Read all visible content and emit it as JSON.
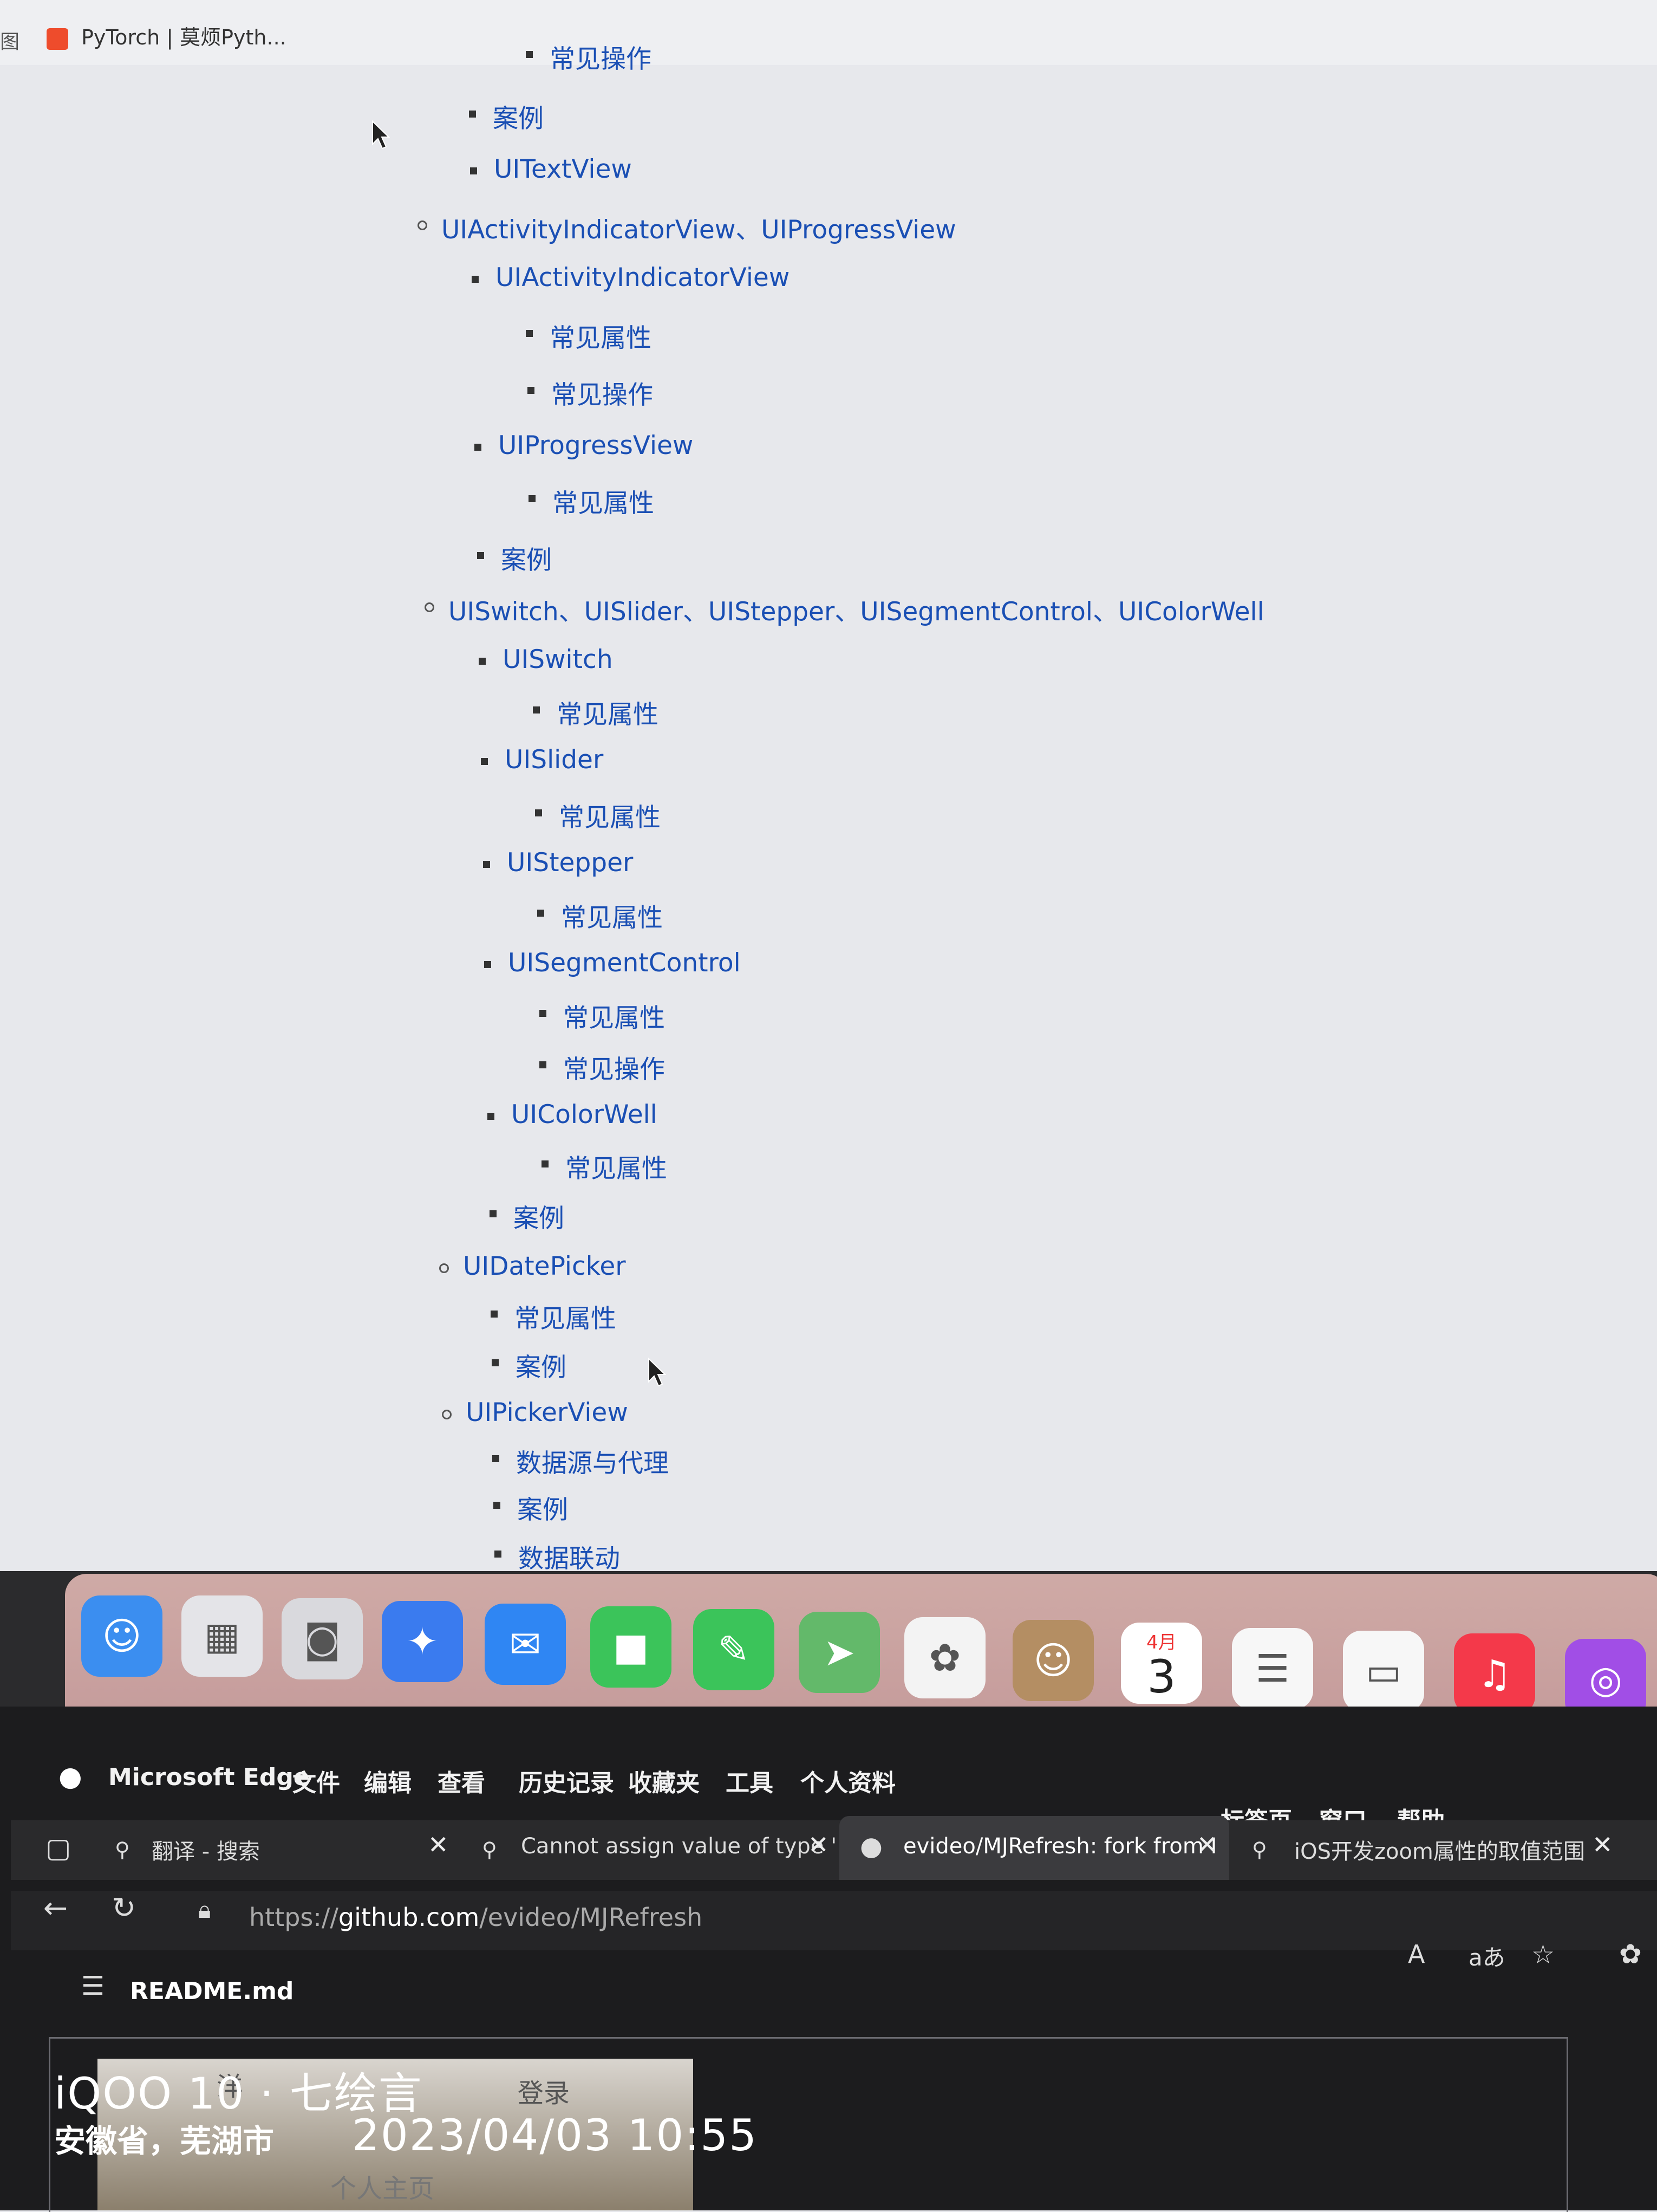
{
  "top_tab": {
    "left_fragment": "图",
    "title": "PyTorch | 莫烦Pyth..."
  },
  "outline": [
    {
      "level": 3,
      "label": "常见操作"
    },
    {
      "level": 2,
      "label": "案例"
    },
    {
      "level": 2,
      "label": "UITextView"
    },
    {
      "level": 1,
      "label": "UIActivityIndicatorView、UIProgressView"
    },
    {
      "level": 2,
      "label": "UIActivityIndicatorView"
    },
    {
      "level": 3,
      "label": "常见属性"
    },
    {
      "level": 3,
      "label": "常见操作"
    },
    {
      "level": 2,
      "label": "UIProgressView"
    },
    {
      "level": 3,
      "label": "常见属性"
    },
    {
      "level": 2,
      "label": "案例"
    },
    {
      "level": 1,
      "label": "UISwitch、UISlider、UIStepper、UISegmentControl、UIColorWell"
    },
    {
      "level": 2,
      "label": "UISwitch"
    },
    {
      "level": 3,
      "label": "常见属性"
    },
    {
      "level": 2,
      "label": "UISlider"
    },
    {
      "level": 3,
      "label": "常见属性"
    },
    {
      "level": 2,
      "label": "UIStepper"
    },
    {
      "level": 3,
      "label": "常见属性"
    },
    {
      "level": 2,
      "label": "UISegmentControl"
    },
    {
      "level": 3,
      "label": "常见属性"
    },
    {
      "level": 3,
      "label": "常见操作"
    },
    {
      "level": 2,
      "label": "UIColorWell"
    },
    {
      "level": 3,
      "label": "常见属性"
    },
    {
      "level": 2,
      "label": "案例"
    },
    {
      "level": 1,
      "label": "UIDatePicker"
    },
    {
      "level": 2,
      "label": "常见属性"
    },
    {
      "level": 2,
      "label": "案例"
    },
    {
      "level": 1,
      "label": "UIPickerView"
    },
    {
      "level": 2,
      "label": "数据源与代理"
    },
    {
      "level": 2,
      "label": "案例"
    },
    {
      "level": 2,
      "label": "数据联动"
    }
  ],
  "dock": {
    "calendar_month": "4月",
    "calendar_day": "3",
    "icons": [
      "finder-icon",
      "launchpad-icon",
      "screenshot-icon",
      "safari-icon",
      "mail-icon",
      "facetime-icon",
      "messages-icon",
      "maps-icon",
      "photos-icon",
      "contacts-icon",
      "calendar-icon",
      "reminders-icon",
      "notes-icon",
      "music-icon",
      "podcasts-icon"
    ]
  },
  "edge": {
    "app_name": "Microsoft Edge",
    "menus": [
      "文件",
      "编辑",
      "查看",
      "历史记录",
      "收藏夹",
      "工具",
      "个人资料"
    ],
    "right_menus": [
      "标签页",
      "窗口",
      "帮助"
    ],
    "tabs": [
      {
        "title": "翻译 - 搜索"
      },
      {
        "title": "Cannot assign value of type '"
      },
      {
        "title": "evideo/MJRefresh: fork from I"
      },
      {
        "title": "iOS开发zoom属性的取值范围"
      }
    ],
    "url_prefix": "https://",
    "url_host": "github.com",
    "url_path": "/evideo/MJRefresh",
    "readme": "README.md",
    "thumb_login": "登录",
    "thumb_profile": "个人主页",
    "thumb_fragment": "洋"
  },
  "watermark": {
    "device": "iQOO 10 · 七绘言",
    "location": "安徽省，芜湖市",
    "datetime": "2023/04/03 10:55"
  },
  "colors": {
    "link": "#1a4fb4",
    "dock": "#c9a3a1",
    "edge_bg": "#1c1c1e"
  }
}
